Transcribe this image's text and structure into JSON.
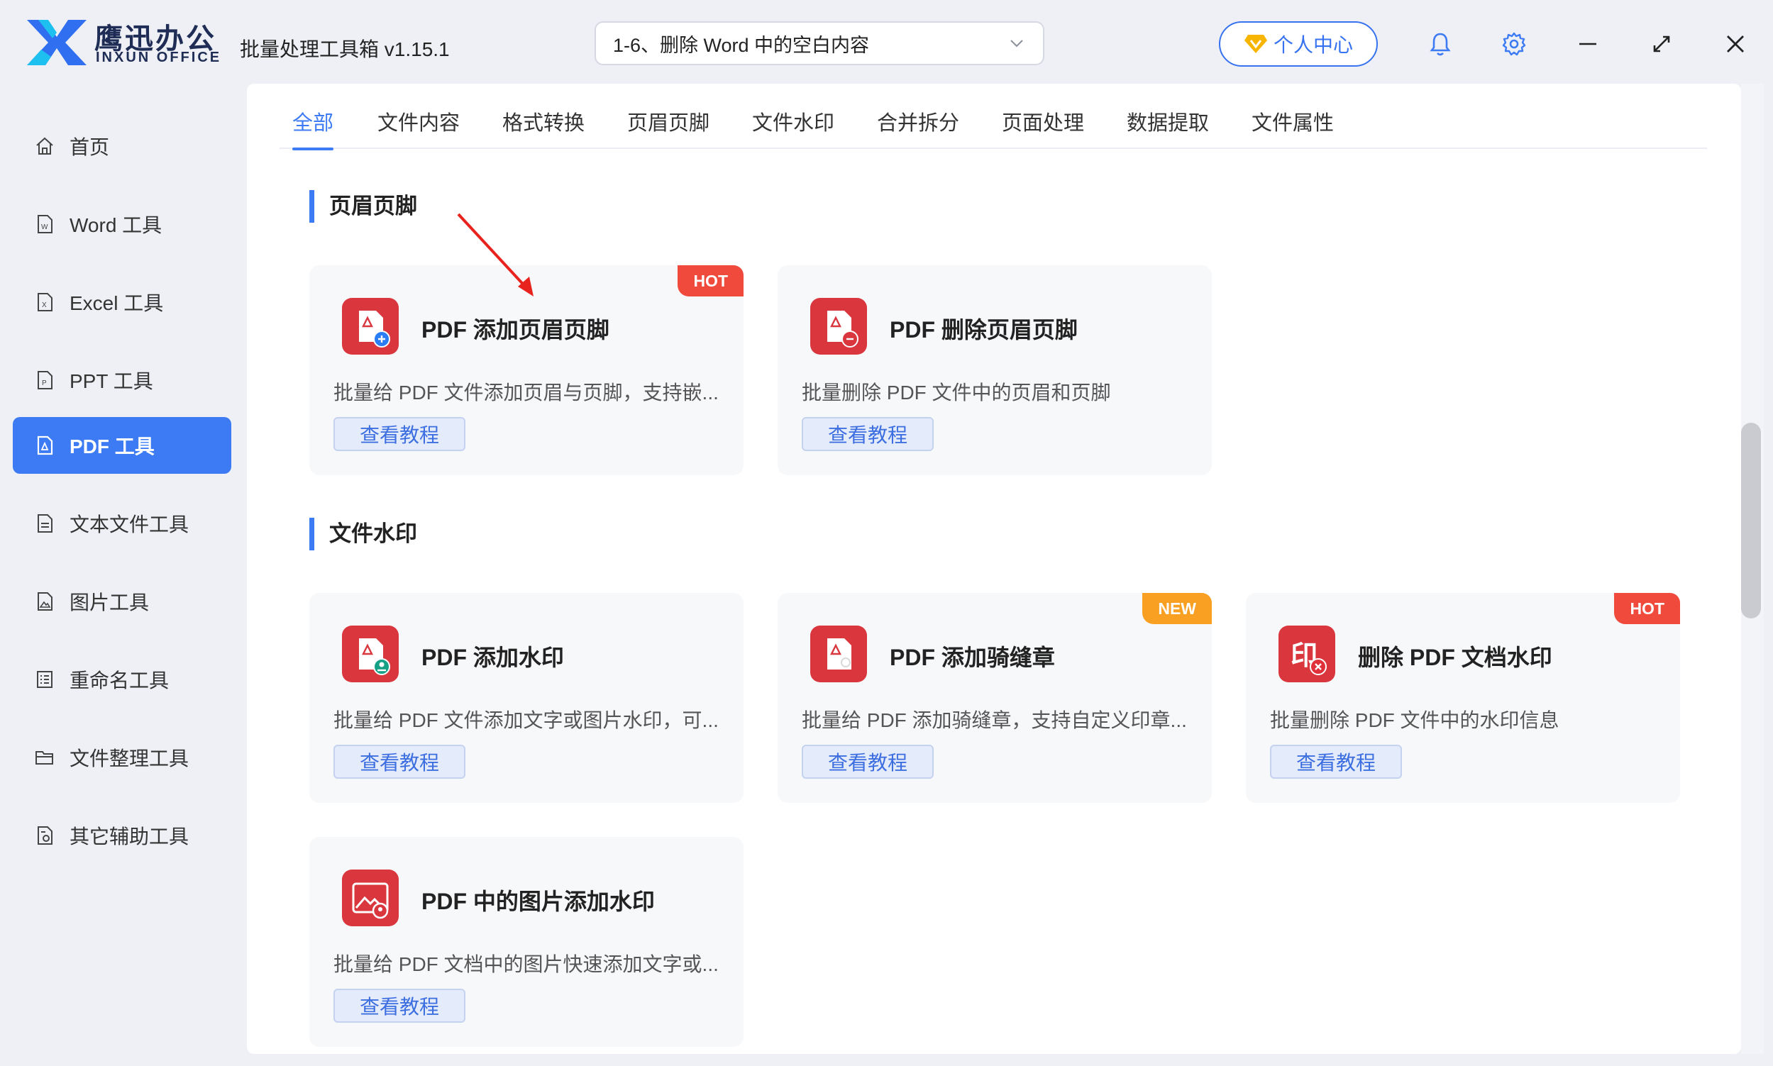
{
  "brand": {
    "name_cn": "鹰迅办公",
    "name_en": "INXUN OFFICE"
  },
  "app": {
    "title": "批量处理工具箱 v1.15.1"
  },
  "task_selector": {
    "value": "1-6、删除 Word 中的空白内容"
  },
  "header": {
    "user_center_label": "个人中心"
  },
  "sidebar": {
    "items": [
      {
        "label": "首页",
        "icon": "home-icon"
      },
      {
        "label": "Word 工具",
        "icon": "word-file-icon"
      },
      {
        "label": "Excel 工具",
        "icon": "excel-file-icon"
      },
      {
        "label": "PPT 工具",
        "icon": "ppt-file-icon"
      },
      {
        "label": "PDF 工具",
        "icon": "pdf-file-icon",
        "active": true
      },
      {
        "label": "文本文件工具",
        "icon": "text-file-icon"
      },
      {
        "label": "图片工具",
        "icon": "image-file-icon"
      },
      {
        "label": "重命名工具",
        "icon": "rename-icon"
      },
      {
        "label": "文件整理工具",
        "icon": "folder-icon"
      },
      {
        "label": "其它辅助工具",
        "icon": "tools-icon"
      }
    ]
  },
  "tabs": [
    {
      "label": "全部",
      "active": true
    },
    {
      "label": "文件内容"
    },
    {
      "label": "格式转换"
    },
    {
      "label": "页眉页脚"
    },
    {
      "label": "文件水印"
    },
    {
      "label": "合并拆分"
    },
    {
      "label": "页面处理"
    },
    {
      "label": "数据提取"
    },
    {
      "label": "文件属性"
    }
  ],
  "sections": [
    {
      "title": "页眉页脚",
      "cards": [
        {
          "title": "PDF 添加页眉页脚",
          "desc": "批量给 PDF 文件添加页眉与页脚，支持嵌...",
          "button": "查看教程",
          "badge": "HOT",
          "icon": "pdf-add-icon"
        },
        {
          "title": "PDF 删除页眉页脚",
          "desc": "批量删除 PDF 文件中的页眉和页脚",
          "button": "查看教程",
          "icon": "pdf-remove-icon"
        }
      ]
    },
    {
      "title": "文件水印",
      "cards": [
        {
          "title": "PDF 添加水印",
          "desc": "批量给 PDF 文件添加文字或图片水印，可...",
          "button": "查看教程",
          "icon": "pdf-watermark-icon"
        },
        {
          "title": "PDF 添加骑缝章",
          "desc": "批量给 PDF 添加骑缝章，支持自定义印章...",
          "button": "查看教程",
          "badge": "NEW",
          "icon": "pdf-seal-icon"
        },
        {
          "title": "删除 PDF 文档水印",
          "desc": "批量删除 PDF 文件中的水印信息",
          "button": "查看教程",
          "badge": "HOT",
          "icon": "remove-watermark-icon"
        },
        {
          "title": "PDF 中的图片添加水印",
          "desc": "批量给 PDF 文档中的图片快速添加文字或...",
          "button": "查看教程",
          "icon": "image-watermark-icon"
        }
      ]
    }
  ],
  "colors": {
    "accent": "#3d7bf5",
    "hot": "#f04a3c",
    "new": "#f9a022",
    "tool_icon": "#d9363e"
  }
}
